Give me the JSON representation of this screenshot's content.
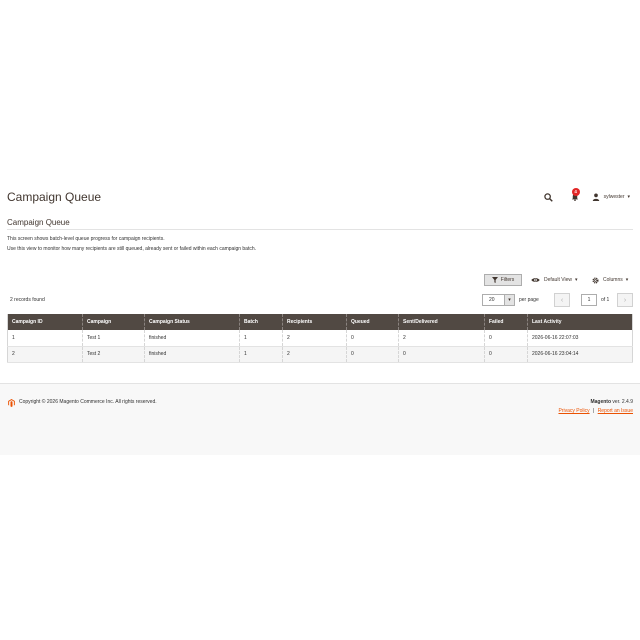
{
  "header": {
    "title": "Campaign Queue",
    "notifications_count": "4",
    "username": "sylwester"
  },
  "section": {
    "title": "Campaign Queue",
    "description_line1": "This screen shows batch-level queue progress for campaign recipients.",
    "description_line2": "Use this view to monitor how many recipients are still queued, already sent or failed within each campaign batch."
  },
  "toolbar": {
    "filters_label": "Filters",
    "view_label": "Default View",
    "columns_label": "Columns"
  },
  "grid": {
    "records_found": "2 records found",
    "per_page_value": "20",
    "per_page_label": "per page",
    "page_value": "1",
    "page_of": "of 1",
    "columns": [
      "Campaign ID",
      "Campaign",
      "Campaign Status",
      "Batch",
      "Recipients",
      "Queued",
      "Sent/Delivered",
      "Failed",
      "Last Activity"
    ],
    "rows": [
      [
        "1",
        "Test 1",
        "finished",
        "1",
        "2",
        "0",
        "2",
        "0",
        "2026-06-16 22:07:03"
      ],
      [
        "2",
        "Test 2",
        "finished",
        "1",
        "2",
        "0",
        "0",
        "0",
        "2026-06-16 23:04:14"
      ]
    ]
  },
  "footer": {
    "copyright": "Copyright © 2026 Magento Commerce Inc. All rights reserved.",
    "brand": "Magento",
    "version": "ver. 2.4.9",
    "privacy_label": "Privacy Policy",
    "separator": "|",
    "report_label": "Report an Issue"
  },
  "colors": {
    "header_bg": "#514943",
    "accent": "#eb5202",
    "badge": "#e22626"
  }
}
